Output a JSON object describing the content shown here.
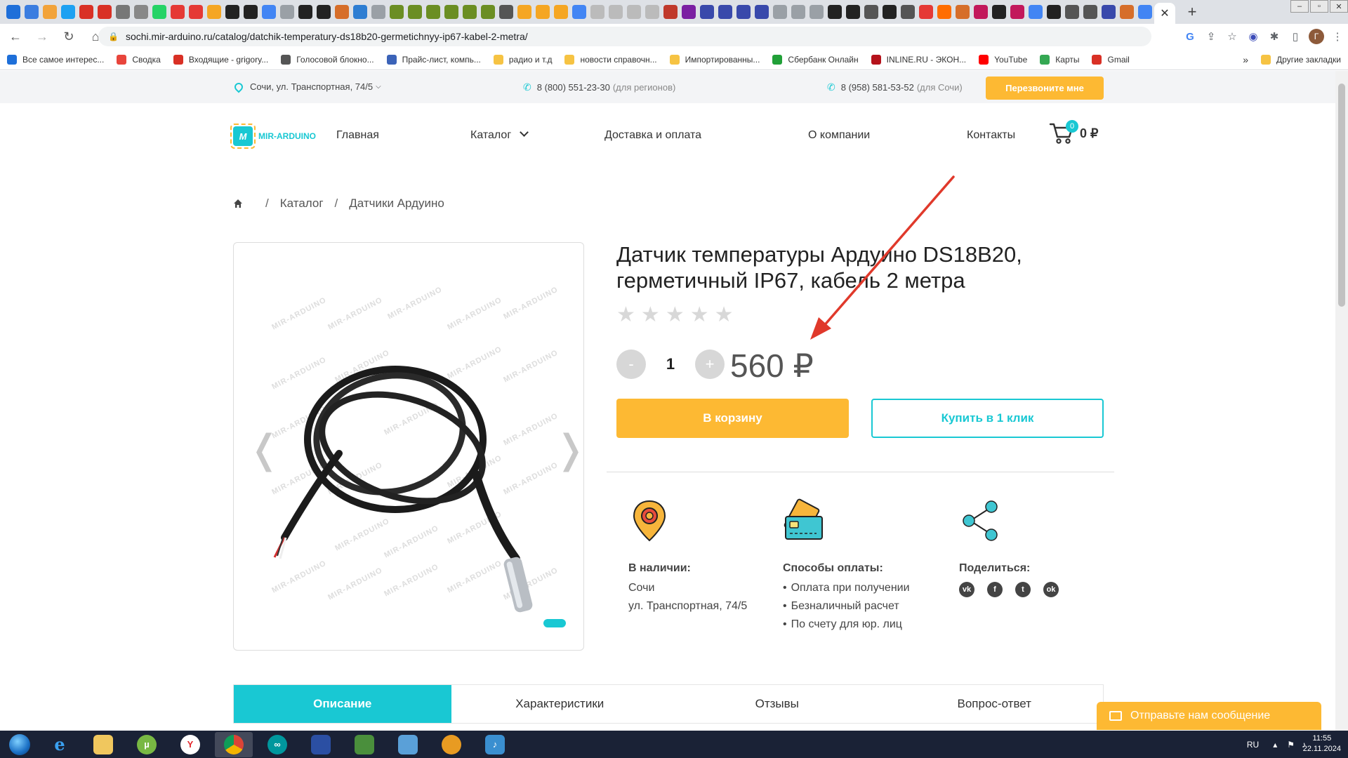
{
  "browser": {
    "url": "sochi.mir-arduino.ru/catalog/datchik-temperatury-ds18b20-germetichnyy-ip67-kabel-2-metra/",
    "bookmarks": [
      {
        "label": "Все самое интерес...",
        "color": "#1e6fd9"
      },
      {
        "label": "Сводка",
        "color": "#e8453c"
      },
      {
        "label": "Входящие - grigory...",
        "color": "#d93025"
      },
      {
        "label": "Голосовой блокно...",
        "color": "#555555"
      },
      {
        "label": "Прайс-лист, компь...",
        "color": "#3b63b8"
      },
      {
        "label": "радио и т.д",
        "color": "#f6c343"
      },
      {
        "label": "новости справочн...",
        "color": "#f6c343"
      },
      {
        "label": "Импортированны...",
        "color": "#f6c343"
      },
      {
        "label": "Сбербанк Онлайн",
        "color": "#21a038"
      },
      {
        "label": "INLINE.RU - ЭКОН...",
        "color": "#b5121b"
      },
      {
        "label": "YouTube",
        "color": "#ff0000"
      },
      {
        "label": "Карты",
        "color": "#34a853"
      },
      {
        "label": "Gmail",
        "color": "#d93025"
      }
    ],
    "bookmarks_more": "»",
    "bookmarks_other": "Другие закладки"
  },
  "topbar": {
    "address": "Сочи, ул. Транспортная, 74/5",
    "phone1": "8 (800) 551-23-30",
    "phone1_note": "(для регионов)",
    "phone2": "8 (958) 581-53-52",
    "phone2_note": "(для Сочи)",
    "callback_label": "Перезвоните мне"
  },
  "header": {
    "logo_text": "MIR-ARDUINO",
    "logo_mark": "M",
    "nav": [
      "Главная",
      "Каталог",
      "Доставка и оплата",
      "О компании",
      "Контакты"
    ],
    "cart_count": "0",
    "cart_total": "0 ₽"
  },
  "breadcrumb": [
    "Каталог",
    "Датчики Ардуино"
  ],
  "gallery": {
    "watermark": "MIR-ARDUINO",
    "prev_arrow": "❬",
    "next_arrow": "❭"
  },
  "product": {
    "title": "Датчик температуры Ардуино DS18B20, герметичный IP67, кабель 2 метра",
    "rating_stars": 5,
    "rating_value": 0,
    "qty_minus": "-",
    "qty_plus": "+",
    "quantity": "1",
    "price": "560 ₽",
    "add_to_cart": "В корзину",
    "buy_one_click": "Купить в 1 клик"
  },
  "info": {
    "stock_head": "В наличии:",
    "stock_city": "Сочи",
    "stock_address": "ул. Транспортная, 74/5",
    "payment_head": "Способы оплаты:",
    "payment_methods": [
      "Оплата при получении",
      "Безналичный расчет",
      "По счету для юр. лиц"
    ],
    "share_head": "Поделиться:",
    "share_networks": [
      "vk",
      "f",
      "t",
      "ok"
    ]
  },
  "tabs": [
    "Описание",
    "Характеристики",
    "Отзывы",
    "Вопрос-ответ"
  ],
  "chat_label": "Отправьте нам сообщение",
  "colors": {
    "accent": "#19c8d3",
    "button_yellow": "#fdb933",
    "annotation_red": "#e0392b"
  },
  "taskbar": {
    "lang": "RU",
    "time": "11:55",
    "date": "22.11.2024"
  }
}
